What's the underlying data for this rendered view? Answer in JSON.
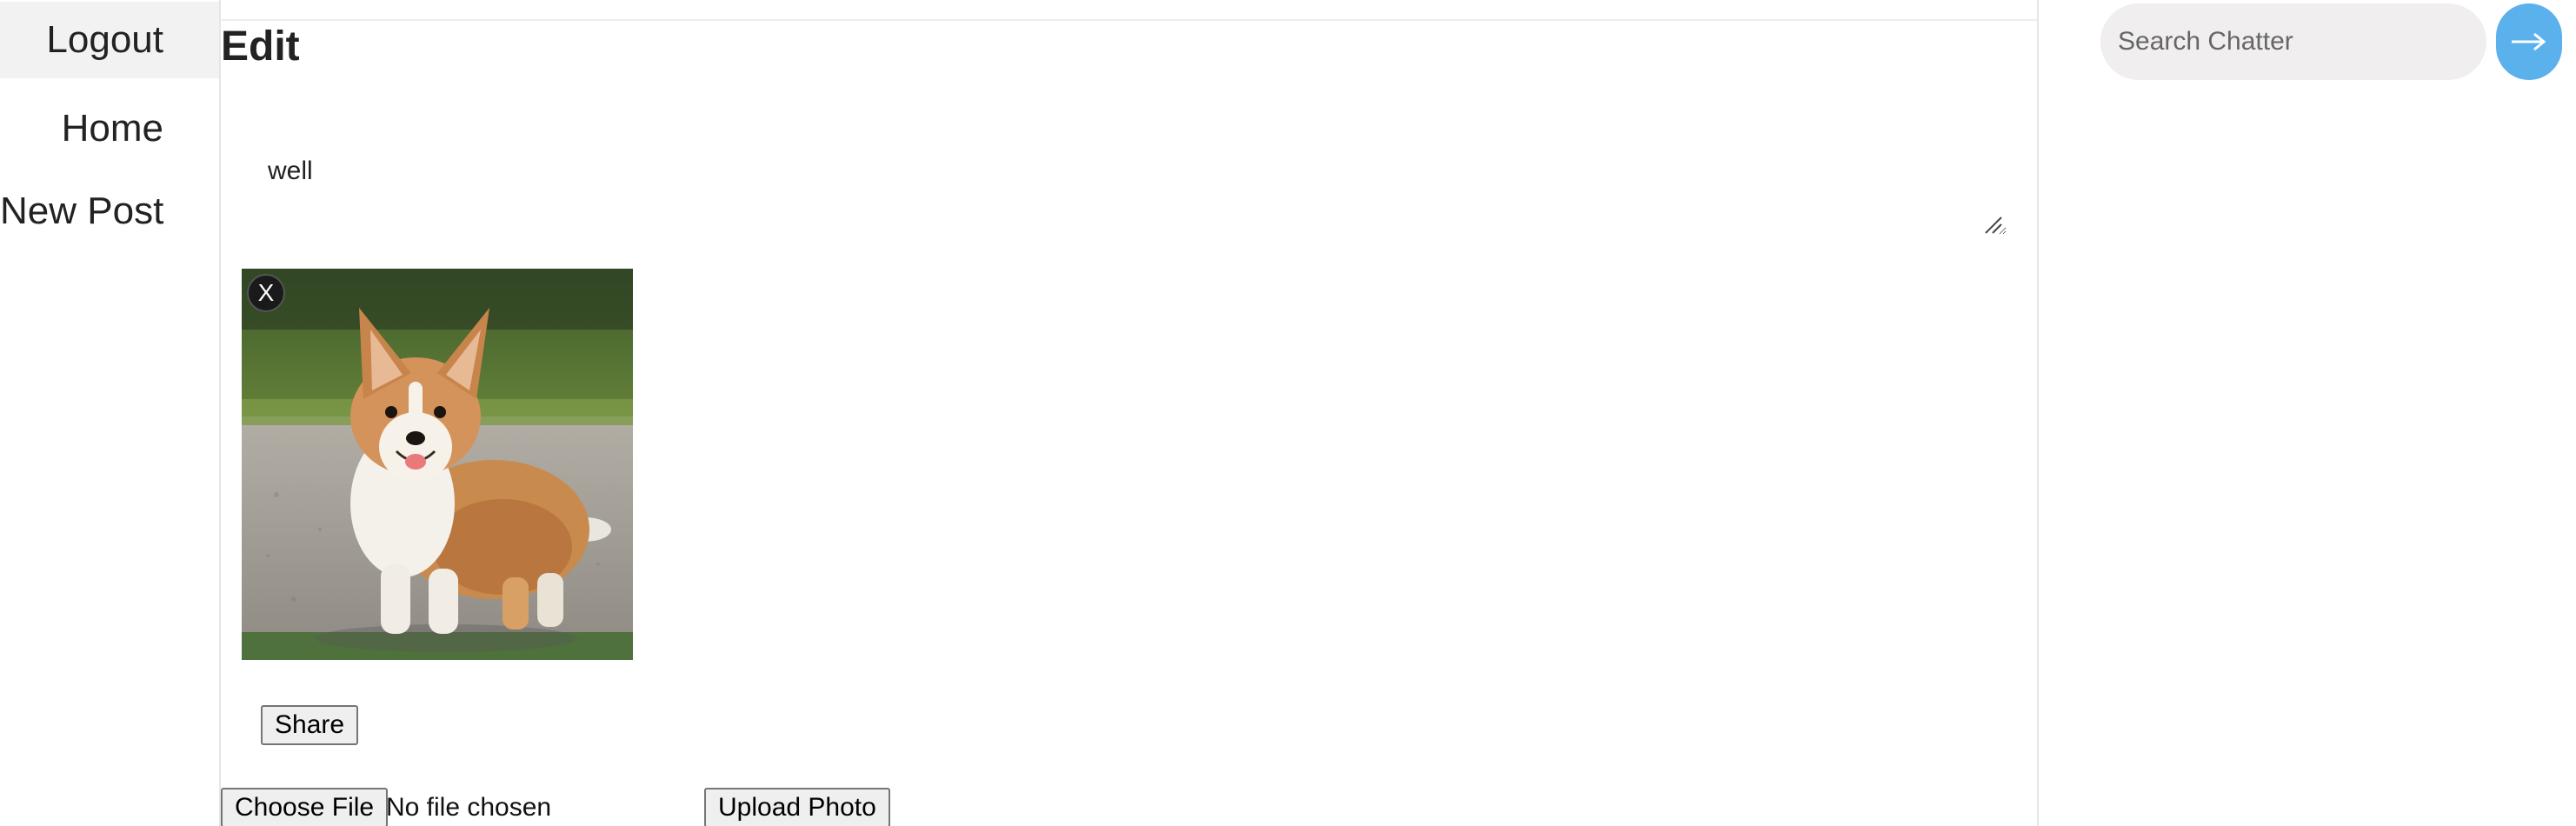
{
  "nav": {
    "items": [
      {
        "label": "Logout"
      },
      {
        "label": "Home"
      },
      {
        "label": "New Post"
      }
    ]
  },
  "page": {
    "title": "Edit"
  },
  "editor": {
    "text_value": "well",
    "remove_photo_label": "X",
    "share_label": "Share",
    "choose_file_label": "Choose File",
    "file_status": "No file chosen",
    "upload_label": "Upload Photo",
    "photo_alt": "Corgi dog standing outdoors"
  },
  "search": {
    "placeholder": "Search Chatter",
    "submit_icon": "arrow-right-icon"
  },
  "colors": {
    "accent": "#5ab1ec",
    "active_nav_bg": "#f2f2f2",
    "search_bg": "#f0eeee"
  }
}
